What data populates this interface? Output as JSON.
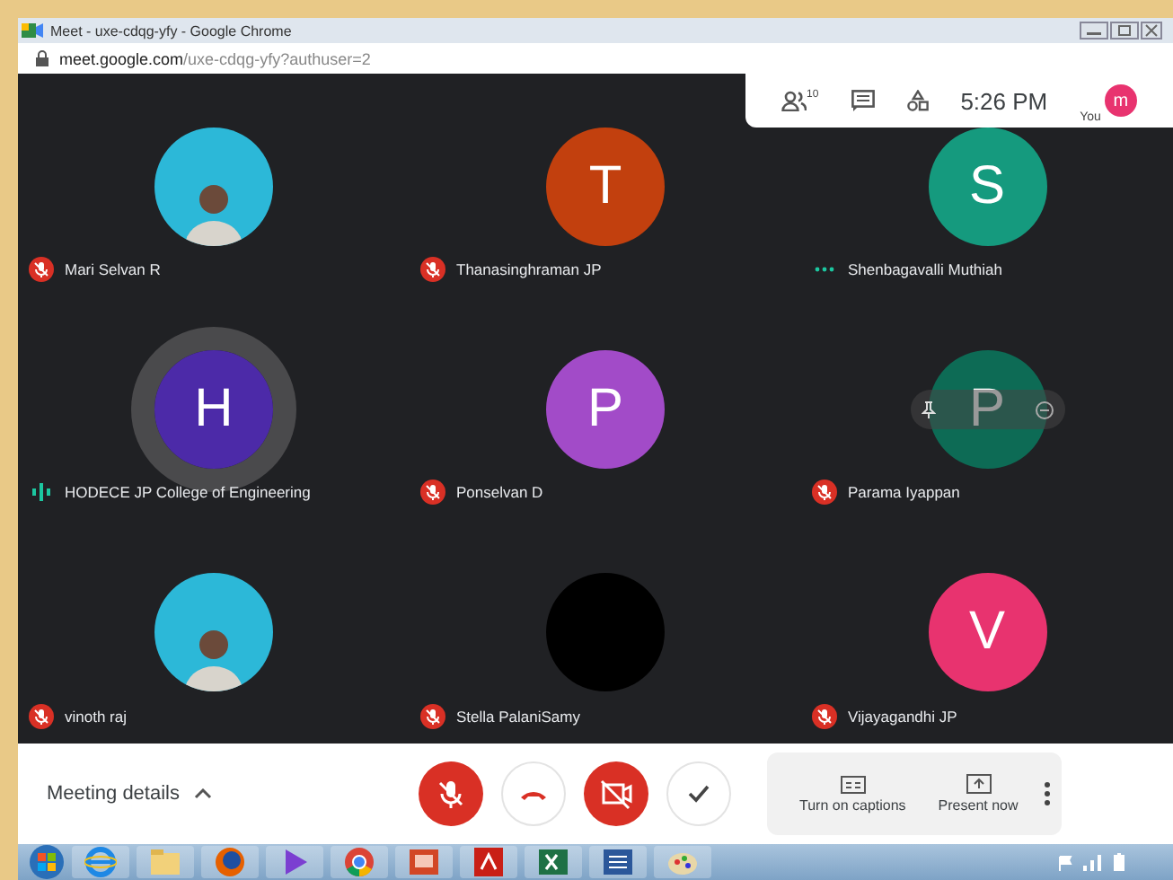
{
  "window": {
    "title": "Meet - uxe-cdqg-yfy - Google Chrome"
  },
  "address_bar": {
    "host": "meet.google.com",
    "path": "/uxe-cdqg-yfy?authuser=2"
  },
  "top_panel": {
    "people_count": "10",
    "time": "5:26 PM",
    "you_label": "You",
    "you_initial": "m"
  },
  "participants": [
    {
      "name": "Mari Selvan R",
      "mic": {
        "kind": "muted"
      },
      "avatar": {
        "kind": "photo"
      },
      "ring": false,
      "hover": false
    },
    {
      "name": "Thanasinghraman JP",
      "mic": {
        "kind": "muted"
      },
      "avatar": {
        "kind": "letter",
        "initial": "T",
        "color": "#c2400e"
      },
      "ring": false,
      "hover": false
    },
    {
      "name": "Shenbagavalli Muthiah",
      "mic": {
        "kind": "idle"
      },
      "avatar": {
        "kind": "letter",
        "initial": "S",
        "color": "#159a7e"
      },
      "ring": false,
      "hover": false
    },
    {
      "name": "HODECE JP College of Engineering",
      "mic": {
        "kind": "speaking"
      },
      "avatar": {
        "kind": "letter",
        "initial": "H",
        "color": "#4c2aa8"
      },
      "ring": true,
      "hover": false
    },
    {
      "name": "Ponselvan D",
      "mic": {
        "kind": "muted"
      },
      "avatar": {
        "kind": "letter",
        "initial": "P",
        "color": "#a24bc8"
      },
      "ring": false,
      "hover": false
    },
    {
      "name": "Parama Iyappan",
      "mic": {
        "kind": "muted"
      },
      "avatar": {
        "kind": "letter",
        "initial": "P",
        "color": "#0d6b55"
      },
      "ring": false,
      "hover": true
    },
    {
      "name": "vinoth raj",
      "mic": {
        "kind": "muted"
      },
      "avatar": {
        "kind": "photo"
      },
      "ring": false,
      "hover": false
    },
    {
      "name": "Stella PalaniSamy",
      "mic": {
        "kind": "muted"
      },
      "avatar": {
        "kind": "logo"
      },
      "ring": false,
      "hover": false
    },
    {
      "name": "Vijayagandhi JP",
      "mic": {
        "kind": "muted"
      },
      "avatar": {
        "kind": "letter",
        "initial": "V",
        "color": "#e8336f"
      },
      "ring": false,
      "hover": false
    }
  ],
  "bottom_bar": {
    "meeting_details": "Meeting details",
    "captions": "Turn on captions",
    "present": "Present now"
  }
}
